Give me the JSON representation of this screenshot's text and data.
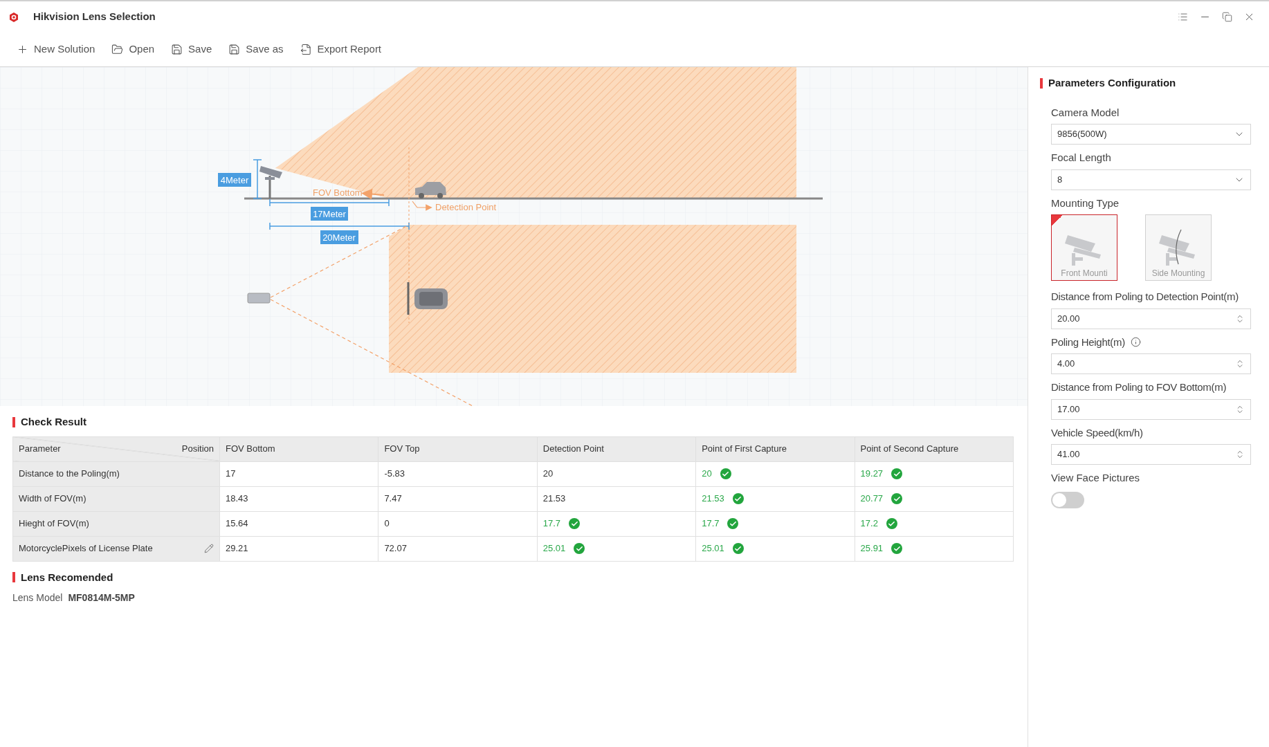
{
  "window": {
    "title": "Hikvision Lens Selection"
  },
  "toolbar": [
    {
      "kind": "new",
      "label": "New Solution"
    },
    {
      "kind": "open",
      "label": "Open"
    },
    {
      "kind": "save",
      "label": "Save"
    },
    {
      "kind": "save_as",
      "label": "Save as"
    },
    {
      "kind": "export",
      "label": "Export Report"
    }
  ],
  "diagram": {
    "height_label": "4Meter",
    "fov_bottom_label": "FOV Bottom",
    "detection_point_label": "Detection Point",
    "fov_distance_label": "17Meter",
    "detection_distance_label": "20Meter"
  },
  "check_result": {
    "title": "Check Result",
    "corner_left": "Parameter",
    "corner_right": "Position",
    "columns": [
      "FOV Bottom",
      "FOV Top",
      "Detection Point",
      "Point of First Capture",
      "Point of Second Capture"
    ],
    "rows": [
      {
        "parameter": "Distance to the Poling(m)",
        "editable": false,
        "cells": [
          {
            "text": "17",
            "passed": false
          },
          {
            "text": "-5.83",
            "passed": false
          },
          {
            "text": "20",
            "passed": false
          },
          {
            "text": "20",
            "passed": true
          },
          {
            "text": "19.27",
            "passed": true
          }
        ]
      },
      {
        "parameter": "Width of FOV(m)",
        "editable": false,
        "cells": [
          {
            "text": "18.43",
            "passed": false
          },
          {
            "text": "7.47",
            "passed": false
          },
          {
            "text": "21.53",
            "passed": false
          },
          {
            "text": "21.53",
            "passed": true
          },
          {
            "text": "20.77",
            "passed": true
          }
        ]
      },
      {
        "parameter": "Hieght of FOV(m)",
        "editable": false,
        "cells": [
          {
            "text": "15.64",
            "passed": false
          },
          {
            "text": "0",
            "passed": false
          },
          {
            "text": "17.7",
            "passed": true
          },
          {
            "text": "17.7",
            "passed": true
          },
          {
            "text": "17.2",
            "passed": true
          }
        ]
      },
      {
        "parameter": "MotorcyclePixels of License Plate",
        "editable": true,
        "cells": [
          {
            "text": "29.21",
            "passed": false
          },
          {
            "text": "72.07",
            "passed": false
          },
          {
            "text": "25.01",
            "passed": true
          },
          {
            "text": "25.01",
            "passed": true
          },
          {
            "text": "25.91",
            "passed": true
          }
        ]
      }
    ]
  },
  "lens": {
    "title": "Lens Recomended",
    "label": "Lens Model",
    "value": "MF0814M-5MP"
  },
  "parameters": {
    "title": "Parameters Configuration",
    "camera_model": {
      "label": "Camera Model",
      "value": "9856(500W)"
    },
    "focal_length": {
      "label": "Focal Length",
      "value": "8"
    },
    "mounting": {
      "label": "Mounting Type",
      "options": [
        {
          "label": "Front Mounti",
          "selected": true
        },
        {
          "label": "Side Mounting",
          "selected": false
        }
      ]
    },
    "numbers": [
      {
        "label": "Distance from Poling to Detection Point(m)",
        "info": false,
        "value": "20.00"
      },
      {
        "label": "Poling Height(m)",
        "info": true,
        "value": "4.00"
      },
      {
        "label": "Distance from Poling to FOV Bottom(m)",
        "info": false,
        "value": "17.00"
      },
      {
        "label": "Vehicle Speed(km/h)",
        "info": false,
        "value": "41.00"
      }
    ],
    "face_pictures": {
      "label": "View Face Pictures",
      "on": false
    }
  }
}
